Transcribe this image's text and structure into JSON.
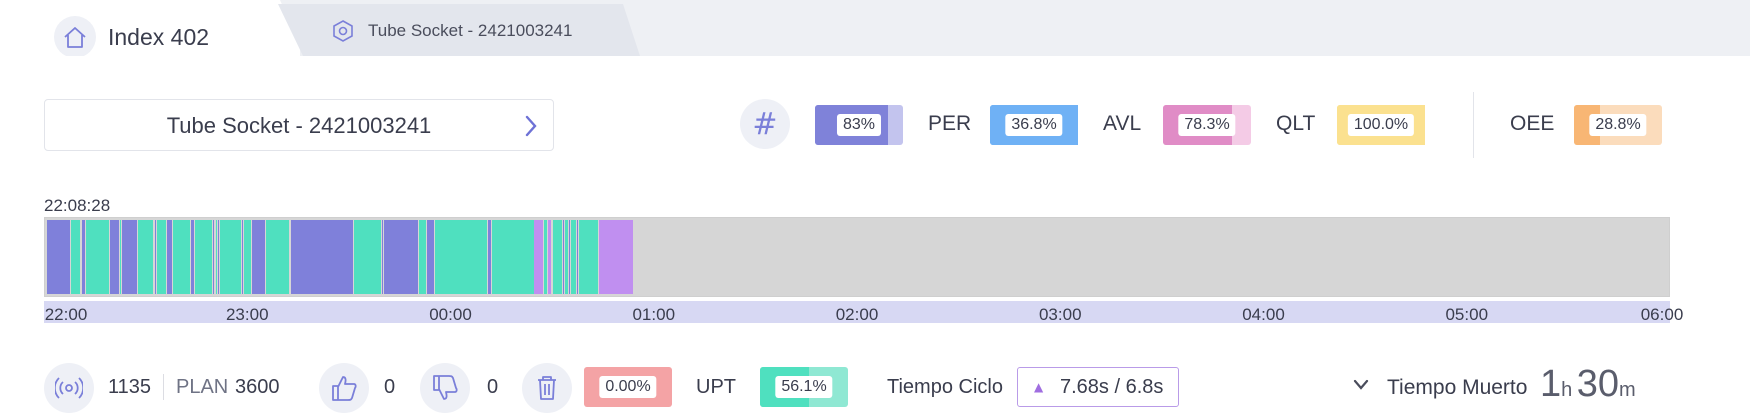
{
  "tabs": {
    "home_label": "Index 402",
    "part_label": "Tube Socket - 2421003241"
  },
  "selector": {
    "label": "Tube Socket - 2421003241"
  },
  "metrics": {
    "hash_symbol": "#",
    "items": [
      {
        "label": "",
        "value": "83%",
        "fraction": 0.83,
        "color": "#7f82d9",
        "bg": "#c3c4ee"
      },
      {
        "label": "PER",
        "value": "36.8%",
        "fraction": 1.0,
        "color": "#6fb1f5",
        "bg": "#6fb1f5"
      },
      {
        "label": "AVL",
        "value": "78.3%",
        "fraction": 0.78,
        "color": "#e08cc6",
        "bg": "#f4cbe6"
      },
      {
        "label": "QLT",
        "value": "100.0%",
        "fraction": 1.0,
        "color": "#fbe18f",
        "bg": "#fbe18f"
      },
      {
        "label": "OEE",
        "value": "28.8%",
        "fraction": 0.29,
        "color": "#f8b674",
        "bg": "#fbdcbc"
      }
    ]
  },
  "timeline": {
    "start_time": "22:08:28",
    "ticks": [
      "22:00",
      "23:00",
      "00:00",
      "01:00",
      "02:00",
      "03:00",
      "04:00",
      "05:00",
      "06:00"
    ],
    "colors": {
      "run": "#4fe0bf",
      "stop": "#7f80da",
      "setup": "#c08ff0",
      "idle": "#d6d6d6"
    },
    "segments": [
      {
        "start": 0.01,
        "end": 0.13,
        "state": "stop"
      },
      {
        "start": 0.13,
        "end": 0.18,
        "state": "run"
      },
      {
        "start": 0.18,
        "end": 0.2,
        "state": "stop"
      },
      {
        "start": 0.2,
        "end": 0.32,
        "state": "run"
      },
      {
        "start": 0.32,
        "end": 0.37,
        "state": "stop"
      },
      {
        "start": 0.37,
        "end": 0.38,
        "state": "run"
      },
      {
        "start": 0.38,
        "end": 0.46,
        "state": "stop"
      },
      {
        "start": 0.46,
        "end": 0.54,
        "state": "run"
      },
      {
        "start": 0.54,
        "end": 0.55,
        "state": "stop"
      },
      {
        "start": 0.55,
        "end": 0.6,
        "state": "run"
      },
      {
        "start": 0.6,
        "end": 0.63,
        "state": "stop"
      },
      {
        "start": 0.63,
        "end": 0.72,
        "state": "run"
      },
      {
        "start": 0.72,
        "end": 0.74,
        "state": "stop"
      },
      {
        "start": 0.74,
        "end": 0.83,
        "state": "run"
      },
      {
        "start": 0.83,
        "end": 0.84,
        "state": "stop"
      },
      {
        "start": 0.84,
        "end": 0.85,
        "state": "run"
      },
      {
        "start": 0.85,
        "end": 0.86,
        "state": "stop"
      },
      {
        "start": 0.86,
        "end": 0.97,
        "state": "run"
      },
      {
        "start": 0.97,
        "end": 0.98,
        "state": "stop"
      },
      {
        "start": 0.98,
        "end": 1.02,
        "state": "run"
      },
      {
        "start": 1.02,
        "end": 1.09,
        "state": "stop"
      },
      {
        "start": 1.09,
        "end": 1.21,
        "state": "run"
      },
      {
        "start": 1.21,
        "end": 1.52,
        "state": "stop"
      },
      {
        "start": 1.52,
        "end": 1.66,
        "state": "run"
      },
      {
        "start": 1.66,
        "end": 1.67,
        "state": "stop"
      },
      {
        "start": 1.67,
        "end": 1.84,
        "state": "stop"
      },
      {
        "start": 1.84,
        "end": 1.88,
        "state": "run"
      },
      {
        "start": 1.88,
        "end": 1.92,
        "state": "stop"
      },
      {
        "start": 1.92,
        "end": 2.18,
        "state": "run"
      },
      {
        "start": 2.18,
        "end": 2.2,
        "state": "stop"
      },
      {
        "start": 2.2,
        "end": 2.41,
        "state": "run"
      },
      {
        "start": 2.41,
        "end": 2.46,
        "state": "setup"
      },
      {
        "start": 2.46,
        "end": 2.48,
        "state": "run"
      },
      {
        "start": 2.48,
        "end": 2.5,
        "state": "setup"
      },
      {
        "start": 2.5,
        "end": 2.55,
        "state": "run"
      },
      {
        "start": 2.55,
        "end": 2.56,
        "state": "stop"
      },
      {
        "start": 2.56,
        "end": 2.58,
        "state": "run"
      },
      {
        "start": 2.58,
        "end": 2.59,
        "state": "stop"
      },
      {
        "start": 2.59,
        "end": 2.62,
        "state": "run"
      },
      {
        "start": 2.62,
        "end": 2.63,
        "state": "stop"
      },
      {
        "start": 2.63,
        "end": 2.73,
        "state": "run"
      },
      {
        "start": 2.73,
        "end": 2.9,
        "state": "setup"
      }
    ]
  },
  "footer": {
    "count": "1135",
    "plan_label": "PLAN",
    "plan_value": "3600",
    "likes": "0",
    "dislikes": "0",
    "scrap_percent": "0.00%",
    "upt_label": "UPT",
    "upt_value": "56.1%",
    "upt_fraction": 0.56,
    "cycle_label": "Tiempo Ciclo",
    "cycle_value": "7.68s  /  6.8s",
    "dead_time_label": "Tiempo Muerto",
    "dead_hours": "1",
    "dead_hours_unit": "h",
    "dead_minutes": "30",
    "dead_minutes_unit": "m"
  }
}
